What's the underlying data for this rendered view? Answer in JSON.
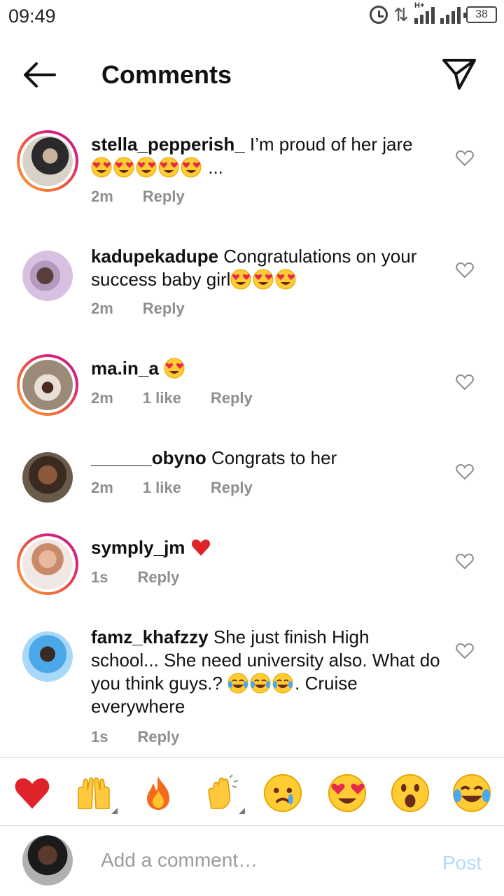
{
  "status_bar": {
    "time": "09:49",
    "battery": "38",
    "network_tag": "H+"
  },
  "header": {
    "title": "Comments"
  },
  "comments": [
    {
      "username": "stella_pepperish_",
      "text": "I’m proud of her jare",
      "emojis": "😍😍😍😍😍",
      "suffix": "...",
      "time": "2m",
      "likes": "",
      "reply": "Reply"
    },
    {
      "username": "kadupekadupe",
      "text": "Congratulations on your success baby girl",
      "emojis": "😍😍😍",
      "suffix": "",
      "time": "2m",
      "likes": "",
      "reply": "Reply"
    },
    {
      "username": "ma.in_a",
      "text": "",
      "emojis": "😍",
      "suffix": "",
      "time": "2m",
      "likes": "1 like",
      "reply": "Reply"
    },
    {
      "username": "______obyno",
      "text": "Congrats to her",
      "emojis": "",
      "suffix": "",
      "time": "2m",
      "likes": "1 like",
      "reply": "Reply"
    },
    {
      "username": "symply_jm",
      "text": "",
      "emojis": "❤️",
      "suffix": "",
      "time": "1s",
      "likes": "",
      "reply": "Reply"
    },
    {
      "username": "famz_khafzzy",
      "text": "She just finish High school... She need university also. What do you think guys.?",
      "emojis": "😂😂😂",
      "suffix": ". Cruise everywhere",
      "time": "1s",
      "likes": "",
      "reply": "Reply"
    }
  ],
  "reactions": [
    {
      "icon": "red-heart-icon",
      "glyph": "❤️"
    },
    {
      "icon": "raising-hands-icon",
      "glyph": "🙌"
    },
    {
      "icon": "fire-icon",
      "glyph": "🔥"
    },
    {
      "icon": "clapping-hands-icon",
      "glyph": "👏"
    },
    {
      "icon": "crying-face-icon",
      "glyph": "😢"
    },
    {
      "icon": "heart-eyes-icon",
      "glyph": "😍"
    },
    {
      "icon": "surprised-face-icon",
      "glyph": "😮"
    },
    {
      "icon": "tears-of-joy-icon",
      "glyph": "😂"
    }
  ],
  "input": {
    "placeholder": "Add a comment…",
    "post_label": "Post"
  },
  "colors": {
    "story_ring_start": "#f9a43a",
    "story_ring_end": "#c5207f",
    "post_disabled": "#b3dbf7",
    "meta_gray": "#8e8e8e"
  }
}
